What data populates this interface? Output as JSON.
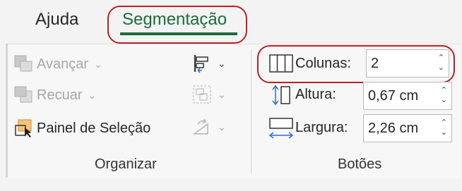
{
  "tabs": [
    {
      "label": "Ajuda"
    },
    {
      "label": "Segmentação"
    }
  ],
  "organizar": {
    "buttons": [
      {
        "label": "Avançar"
      },
      {
        "label": "Recuar"
      },
      {
        "label": "Painel de Seleção"
      }
    ],
    "group_label": "Organizar"
  },
  "botoes": {
    "fields": [
      {
        "label": "Colunas:",
        "value": "2"
      },
      {
        "label": "Altura:",
        "value": "0,67 cm"
      },
      {
        "label": "Largura:",
        "value": "2,26 cm"
      }
    ],
    "group_label": "Botões"
  },
  "colors": {
    "accent_green": "#1e6b3a",
    "annotation_red": "#b2242a"
  }
}
